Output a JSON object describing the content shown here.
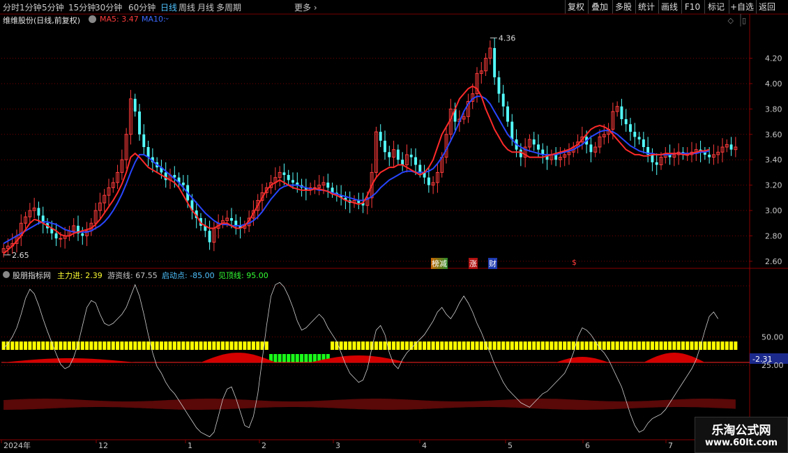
{
  "toolbar": {
    "periods": [
      {
        "label": "分时",
        "active": false
      },
      {
        "label": "1分钟",
        "active": false
      },
      {
        "label": "5分钟",
        "active": false
      },
      {
        "label": "15分钟",
        "active": false
      },
      {
        "label": "30分钟",
        "active": false
      },
      {
        "label": "60分钟",
        "active": false
      },
      {
        "label": "日线",
        "active": true
      },
      {
        "label": "周线",
        "active": false
      },
      {
        "label": "月线",
        "active": false
      },
      {
        "label": "多周期",
        "active": false
      }
    ],
    "more_label": "更多",
    "right_buttons": [
      "复权",
      "叠加",
      "多股",
      "统计",
      "画线",
      "F10",
      "标记",
      "+自选",
      "返回"
    ]
  },
  "main_info": {
    "stock_name": "维维股份(日线,前复权)",
    "ma5_label": "MA5: 3.47",
    "ma10_label": "MA10:"
  },
  "indicator_info": {
    "name": "股朋指标网",
    "main_in": "主力进: 2.39",
    "youzi": "游资线: 67.55",
    "start_point": "启动点: -85.00",
    "top_line": "见顶线: 95.00"
  },
  "event_tags": [
    "榜减",
    "涨",
    "财",
    "$"
  ],
  "watermark": {
    "title": "乐淘公式网",
    "url": "www.60lt.com"
  },
  "colors": {
    "up": "#ff3b3b",
    "down": "#54ffff",
    "ma5": "#ff2a2a",
    "ma10": "#2846ff",
    "yellow": "#ffff00",
    "green": "#1aff1a",
    "grid": "#7a0000",
    "white_line": "#cfcfcf"
  },
  "chart_data": [
    {
      "type": "candlestick",
      "title": "维维股份(日线,前复权)",
      "ylim": [
        2.55,
        4.45
      ],
      "y_ticks": [
        2.6,
        2.8,
        3.0,
        3.2,
        3.4,
        3.6,
        3.8,
        4.0,
        4.2
      ],
      "high_label": "4.36",
      "low_label": "2.65",
      "x_labels": [
        "2024年",
        "12",
        "1",
        "2",
        "3",
        "4",
        "5",
        "6",
        "7"
      ],
      "series": [
        {
          "name": "MA5",
          "role": "ma5"
        },
        {
          "name": "MA10",
          "role": "ma10"
        }
      ],
      "closes": [
        2.7,
        2.72,
        2.74,
        2.8,
        2.9,
        2.95,
        3.0,
        3.02,
        2.96,
        2.9,
        2.86,
        2.82,
        2.78,
        2.78,
        2.8,
        2.84,
        2.88,
        2.82,
        2.8,
        2.84,
        2.9,
        3.0,
        3.06,
        3.12,
        3.18,
        3.22,
        3.3,
        3.4,
        3.6,
        3.88,
        3.78,
        3.6,
        3.5,
        3.42,
        3.38,
        3.34,
        3.3,
        3.24,
        3.28,
        3.26,
        3.22,
        3.2,
        3.08,
        3.0,
        2.94,
        2.88,
        2.84,
        2.75,
        2.86,
        2.9,
        2.92,
        2.94,
        2.92,
        2.88,
        2.86,
        2.88,
        2.94,
        3.0,
        3.08,
        3.14,
        3.18,
        3.22,
        3.26,
        3.3,
        3.28,
        3.24,
        3.22,
        3.2,
        3.18,
        3.16,
        3.18,
        3.18,
        3.2,
        3.22,
        3.18,
        3.14,
        3.12,
        3.1,
        3.08,
        3.06,
        3.08,
        3.06,
        3.04,
        3.1,
        3.3,
        3.62,
        3.55,
        3.46,
        3.42,
        3.48,
        3.4,
        3.36,
        3.44,
        3.42,
        3.36,
        3.3,
        3.26,
        3.2,
        3.22,
        3.3,
        3.42,
        3.6,
        3.8,
        3.7,
        3.72,
        3.74,
        3.86,
        3.92,
        4.08,
        4.1,
        4.2,
        4.28,
        4.05,
        3.92,
        3.82,
        3.7,
        3.56,
        3.48,
        3.42,
        3.5,
        3.56,
        3.52,
        3.48,
        3.44,
        3.4,
        3.44,
        3.4,
        3.42,
        3.44,
        3.46,
        3.5,
        3.54,
        3.58,
        3.52,
        3.46,
        3.5,
        3.58,
        3.6,
        3.64,
        3.78,
        3.82,
        3.72,
        3.68,
        3.62,
        3.58,
        3.56,
        3.5,
        3.44,
        3.38,
        3.36,
        3.42,
        3.44,
        3.42,
        3.44,
        3.46,
        3.44,
        3.44,
        3.46,
        3.48,
        3.46,
        3.44,
        3.42,
        3.44,
        3.46,
        3.5,
        3.52,
        3.48,
        3.5
      ],
      "ma5": [
        2.66,
        2.69,
        2.72,
        2.76,
        2.8,
        2.85,
        2.9,
        2.93,
        2.92,
        2.9,
        2.88,
        2.86,
        2.84,
        2.81,
        2.8,
        2.8,
        2.82,
        2.83,
        2.84,
        2.85,
        2.86,
        2.89,
        2.93,
        2.98,
        3.03,
        3.08,
        3.14,
        3.21,
        3.3,
        3.42,
        3.45,
        3.42,
        3.38,
        3.34,
        3.32,
        3.3,
        3.28,
        3.26,
        3.24,
        3.22,
        3.18,
        3.12,
        3.06,
        3.0,
        2.96,
        2.9,
        2.88,
        2.86,
        2.86,
        2.88,
        2.9,
        2.9,
        2.88,
        2.86,
        2.86,
        2.88,
        2.92,
        2.98,
        3.04,
        3.1,
        3.16,
        3.2,
        3.22,
        3.24,
        3.22,
        3.2,
        3.18,
        3.17,
        3.16,
        3.16,
        3.16,
        3.17,
        3.17,
        3.16,
        3.15,
        3.13,
        3.12,
        3.1,
        3.08,
        3.07,
        3.06,
        3.05,
        3.06,
        3.12,
        3.2,
        3.26,
        3.3,
        3.32,
        3.34,
        3.34,
        3.36,
        3.36,
        3.34,
        3.32,
        3.3,
        3.28,
        3.3,
        3.34,
        3.4,
        3.5,
        3.6,
        3.66,
        3.72,
        3.8,
        3.88,
        3.92,
        3.96,
        3.98,
        3.96,
        3.9,
        3.8,
        3.72,
        3.64,
        3.58,
        3.52,
        3.48,
        3.46,
        3.46,
        3.46,
        3.44,
        3.42,
        3.42,
        3.42,
        3.42,
        3.43,
        3.44,
        3.45,
        3.46,
        3.47,
        3.48,
        3.5,
        3.52,
        3.56,
        3.6,
        3.64,
        3.66,
        3.67,
        3.66,
        3.64,
        3.6,
        3.56,
        3.52,
        3.48,
        3.46,
        3.44,
        3.44,
        3.43,
        3.43,
        3.44,
        3.44,
        3.44,
        3.45,
        3.45,
        3.45,
        3.45,
        3.44,
        3.44,
        3.45,
        3.46,
        3.47,
        3.47,
        3.48
      ],
      "ma10": [
        2.74,
        2.76,
        2.78,
        2.8,
        2.82,
        2.84,
        2.86,
        2.88,
        2.9,
        2.91,
        2.91,
        2.9,
        2.89,
        2.87,
        2.85,
        2.84,
        2.83,
        2.83,
        2.83,
        2.83,
        2.84,
        2.86,
        2.88,
        2.91,
        2.95,
        3.0,
        3.06,
        3.13,
        3.21,
        3.3,
        3.38,
        3.44,
        3.44,
        3.42,
        3.39,
        3.36,
        3.34,
        3.31,
        3.28,
        3.25,
        3.22,
        3.18,
        3.14,
        3.1,
        3.06,
        3.02,
        2.98,
        2.95,
        2.92,
        2.9,
        2.89,
        2.89,
        2.88,
        2.88,
        2.88,
        2.89,
        2.9,
        2.92,
        2.95,
        2.99,
        3.04,
        3.09,
        3.13,
        3.17,
        3.19,
        3.2,
        3.2,
        3.2,
        3.19,
        3.18,
        3.17,
        3.17,
        3.16,
        3.16,
        3.15,
        3.14,
        3.13,
        3.12,
        3.11,
        3.1,
        3.09,
        3.08,
        3.08,
        3.09,
        3.11,
        3.14,
        3.18,
        3.21,
        3.24,
        3.26,
        3.28,
        3.3,
        3.31,
        3.31,
        3.3,
        3.3,
        3.3,
        3.31,
        3.33,
        3.37,
        3.42,
        3.48,
        3.55,
        3.62,
        3.7,
        3.78,
        3.84,
        3.88,
        3.9,
        3.9,
        3.88,
        3.84,
        3.78,
        3.72,
        3.66,
        3.6,
        3.56,
        3.52,
        3.5,
        3.48,
        3.47,
        3.46,
        3.45,
        3.44,
        3.44,
        3.44,
        3.44,
        3.45,
        3.46,
        3.47,
        3.48,
        3.5,
        3.52,
        3.55,
        3.58,
        3.6,
        3.62,
        3.63,
        3.63,
        3.62,
        3.6,
        3.57,
        3.54,
        3.51,
        3.49,
        3.47,
        3.46,
        3.45,
        3.45,
        3.44,
        3.44,
        3.44,
        3.44,
        3.45,
        3.45,
        3.45,
        3.45,
        3.45,
        3.45,
        3.46,
        3.46,
        3.47
      ]
    },
    {
      "type": "line",
      "title": "股朋指标网",
      "ylim": [
        -40,
        100
      ],
      "y_ticks": [
        50.0,
        25.0
      ],
      "current_label": "-2.31",
      "series": [
        {
          "name": "游资线",
          "values": [
            40,
            44,
            50,
            58,
            70,
            84,
            92,
            88,
            78,
            66,
            55,
            45,
            35,
            26,
            22,
            24,
            32,
            44,
            60,
            76,
            82,
            80,
            70,
            62,
            60,
            62,
            66,
            70,
            76,
            86,
            96,
            86,
            70,
            52,
            36,
            24,
            18,
            10,
            4,
            0,
            -6,
            -12,
            -18,
            -24,
            -30,
            -34,
            -36,
            -38,
            -34,
            -20,
            -5,
            4,
            6,
            -4,
            -16,
            -28,
            -30,
            -20,
            0,
            30,
            60,
            86,
            96,
            98,
            94,
            86,
            76,
            64,
            56,
            58,
            62,
            66,
            70,
            66,
            58,
            52,
            46,
            36,
            26,
            18,
            14,
            10,
            12,
            22,
            40,
            56,
            60,
            52,
            36,
            26,
            22,
            30,
            36,
            40,
            44,
            48,
            52,
            58,
            64,
            72,
            76,
            70,
            66,
            72,
            80,
            86,
            80,
            72,
            62,
            54,
            44,
            36,
            26,
            18,
            10,
            4,
            0,
            -4,
            -8,
            -10,
            -12,
            -8,
            -4,
            0,
            2,
            6,
            10,
            14,
            18,
            26,
            36,
            50,
            58,
            56,
            52,
            46,
            40,
            36,
            30,
            22,
            14,
            6,
            -6,
            -18,
            -28,
            -34,
            -32,
            -26,
            -22,
            -20,
            -18,
            -14,
            -8,
            -2,
            4,
            10,
            16,
            22,
            30,
            42,
            56,
            68,
            72,
            66
          ]
        },
        {
          "name": "主力进",
          "role": "yellow/green bars"
        }
      ],
      "bar_segments": [
        {
          "color": "yellow",
          "from": 0,
          "to": 60
        },
        {
          "color": "green",
          "from": 61,
          "to": 74
        },
        {
          "color": "yellow",
          "from": 75,
          "to": 186
        },
        {
          "color": "green",
          "from": 187,
          "to": 215
        }
      ]
    }
  ]
}
